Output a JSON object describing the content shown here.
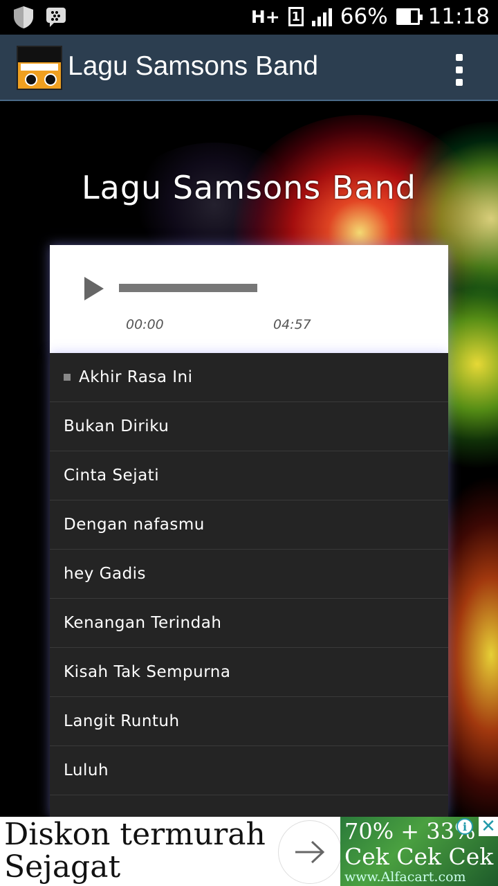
{
  "status_bar": {
    "network": "H+",
    "sim": "1",
    "battery_percent": "66%",
    "battery_level": 0.66,
    "time": "11:18",
    "icons": [
      "shield-icon",
      "bbm-icon",
      "signal-icon",
      "battery-icon"
    ]
  },
  "app_bar": {
    "title": "Lagu Samsons Band",
    "logo_text": "SAMSONS BAND",
    "menu_icon": "overflow-menu-icon"
  },
  "hero": {
    "title": "Lagu Samsons Band"
  },
  "player": {
    "play_icon": "play-icon",
    "current_time": "00:00",
    "total_time": "04:57",
    "progress": 0
  },
  "songs": [
    "Akhir Rasa Ini",
    "Bukan Diriku",
    "Cinta Sejati",
    "Dengan nafasmu",
    "hey Gadis",
    "Kenangan Terindah",
    "Kisah Tak Sempurna",
    "Langit Runtuh",
    "Luluh",
    ""
  ],
  "selected_song_index": 0,
  "ad": {
    "headline": "Diskon termurah Sejagat",
    "offer": "70% + 33%",
    "cta": "Cek Cek Cek",
    "url": "www.Alfacart.com",
    "info_label": "i",
    "close_label": "✕"
  }
}
